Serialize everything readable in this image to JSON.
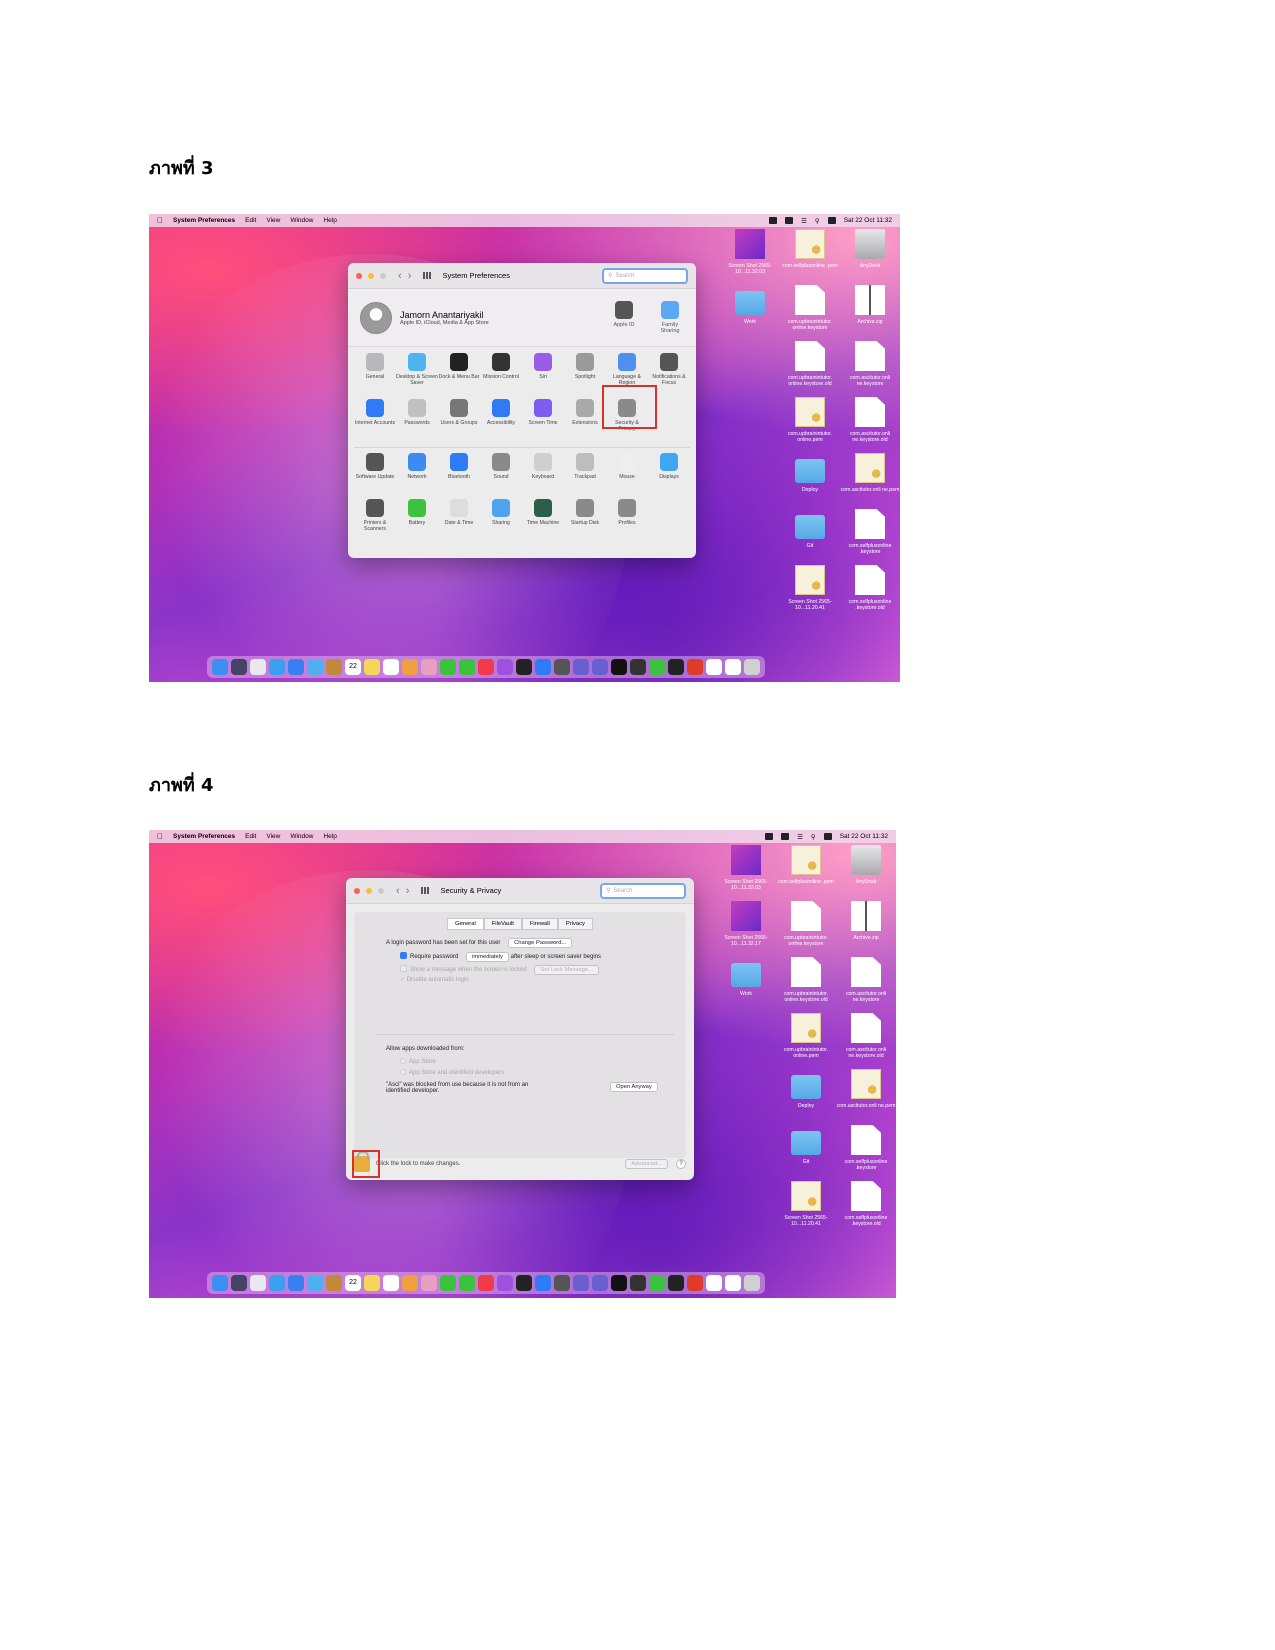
{
  "captions": {
    "fig3": "ภาพที่ 3",
    "fig4": "ภาพที่ 4"
  },
  "menubar": {
    "apple": "",
    "app": "System Preferences",
    "items": [
      "Edit",
      "View",
      "Window",
      "Help"
    ],
    "clock": "Sat 22 Oct 11:32"
  },
  "shot3": {
    "window_title": "System Preferences",
    "search_placeholder": "Search",
    "user_name": "Jamorn Anantariyakil",
    "user_sub": "Apple ID, iCloud, Media & App Store",
    "profile_icons": [
      {
        "label": "Apple ID",
        "icon": "apple-id-icon",
        "color": "#555555"
      },
      {
        "label": "Family Sharing",
        "icon": "family-sharing-icon",
        "color": "#5aa9f5"
      }
    ],
    "rows": [
      [
        {
          "label": "General",
          "icon": "general-icon",
          "color": "#b9b9bd"
        },
        {
          "label": "Desktop & Screen Saver",
          "icon": "desktop-icon",
          "color": "#4fb3f0"
        },
        {
          "label": "Dock & Menu Bar",
          "icon": "dock-icon",
          "color": "#222222"
        },
        {
          "label": "Mission Control",
          "icon": "mission-control-icon",
          "color": "#333333"
        },
        {
          "label": "Siri",
          "icon": "siri-icon",
          "color": "#9b5de5"
        },
        {
          "label": "Spotlight",
          "icon": "spotlight-icon",
          "color": "#9a9a9a"
        },
        {
          "label": "Language & Region",
          "icon": "language-icon",
          "color": "#4f8ff0"
        },
        {
          "label": "Notifications & Focus",
          "icon": "notifications-icon",
          "color": "#555555"
        }
      ],
      [
        {
          "label": "Internet Accounts",
          "icon": "internet-accounts-icon",
          "color": "#2f7bf6"
        },
        {
          "label": "Passwords",
          "icon": "passwords-icon",
          "color": "#c0c0c0"
        },
        {
          "label": "Users & Groups",
          "icon": "users-icon",
          "color": "#777777"
        },
        {
          "label": "Accessibility",
          "icon": "accessibility-icon",
          "color": "#2f7bf6"
        },
        {
          "label": "Screen Time",
          "icon": "screen-time-icon",
          "color": "#7b5ef0"
        },
        {
          "label": "Extensions",
          "icon": "extensions-icon",
          "color": "#aaaaaa"
        },
        {
          "label": "Security & Privacy",
          "icon": "security-icon",
          "color": "#8a8a8a"
        },
        {
          "label": "",
          "icon": "",
          "color": "transparent"
        }
      ],
      [
        {
          "label": "Software Update",
          "icon": "software-update-icon",
          "color": "#555555"
        },
        {
          "label": "Network",
          "icon": "network-icon",
          "color": "#3d8bf0"
        },
        {
          "label": "Bluetooth",
          "icon": "bluetooth-icon",
          "color": "#2f7bf6"
        },
        {
          "label": "Sound",
          "icon": "sound-icon",
          "color": "#8a8a8a"
        },
        {
          "label": "Keyboard",
          "icon": "keyboard-icon",
          "color": "#cfcfcf"
        },
        {
          "label": "Trackpad",
          "icon": "trackpad-icon",
          "color": "#bdbdbd"
        },
        {
          "label": "Mouse",
          "icon": "mouse-icon",
          "color": "#eeeeee"
        },
        {
          "label": "Displays",
          "icon": "displays-icon",
          "color": "#3fa6f2"
        }
      ],
      [
        {
          "label": "Printers & Scanners",
          "icon": "printer-icon",
          "color": "#555555"
        },
        {
          "label": "Battery",
          "icon": "battery-icon",
          "color": "#3cc23c"
        },
        {
          "label": "Date & Time",
          "icon": "clock-icon",
          "color": "#dddddd"
        },
        {
          "label": "Sharing",
          "icon": "sharing-icon",
          "color": "#4fa3ee"
        },
        {
          "label": "Time Machine",
          "icon": "time-machine-icon",
          "color": "#2d5e4a"
        },
        {
          "label": "Startup Disk",
          "icon": "startup-disk-icon",
          "color": "#8a8a8a"
        },
        {
          "label": "Profiles",
          "icon": "profiles-icon",
          "color": "#8a8a8a"
        },
        {
          "label": "",
          "icon": "",
          "color": "transparent"
        }
      ]
    ]
  },
  "shot4": {
    "window_title": "Security & Privacy",
    "search_placeholder": "Search",
    "tabs": [
      "General",
      "FileVault",
      "Firewall",
      "Privacy"
    ],
    "login_text": "A login password has been set for this user",
    "change_password": "Change Password...",
    "require_password": "Require password",
    "require_value": "immediately",
    "require_suffix": "after sleep or screen saver begins",
    "show_message": "Show a message when the screen is locked",
    "set_lock_message": "Set Lock Message...",
    "disable_login": "Disable automatic login",
    "allow_apps": "Allow apps downloaded from:",
    "opt_app_store": "App Store",
    "opt_identified": "App Store and identified developers",
    "blocked_text_1": "\"Asci\" was blocked from use because it is not from an",
    "blocked_text_2": "identified developer.",
    "open_anyway": "Open Anyway",
    "lock_text": "Click the lock to make changes.",
    "advanced": "Advanced...",
    "help": "?"
  },
  "desktop3": [
    {
      "label": "Screen Shot 2565-10...11.32.03",
      "kind": "shotimg"
    },
    {
      "label": "com.selfplusonline .pem",
      "kind": "cert"
    },
    {
      "label": "AnyDesk",
      "kind": "disk"
    },
    {
      "label": "Work",
      "kind": "folder"
    },
    {
      "label": "com.upbrainintutor. online.keystore",
      "kind": "doc"
    },
    {
      "label": "Archive.zip",
      "kind": "zip"
    },
    {
      "label": "",
      "kind": ""
    },
    {
      "label": "com.upbrainintutor. online.keystore.old",
      "kind": "doc"
    },
    {
      "label": "com.ascitutor.onli ne.keystore",
      "kind": "doc"
    },
    {
      "label": "",
      "kind": ""
    },
    {
      "label": "com.upbrainintutor. online.pem",
      "kind": "cert"
    },
    {
      "label": "com.ascitutor.onli ne.keystore.old",
      "kind": "doc"
    },
    {
      "label": "",
      "kind": ""
    },
    {
      "label": "Deploy",
      "kind": "folder"
    },
    {
      "label": "com.ascitutor.onli ne.pem",
      "kind": "cert"
    },
    {
      "label": "",
      "kind": ""
    },
    {
      "label": "Git",
      "kind": "folder"
    },
    {
      "label": "com.selfplusonline .keystore",
      "kind": "doc"
    },
    {
      "label": "",
      "kind": ""
    },
    {
      "label": "Screen Shot 2565-10...11.20.41",
      "kind": "cert"
    },
    {
      "label": "com.selfplusonline .keystore.old",
      "kind": "doc"
    }
  ],
  "desktop4": [
    {
      "label": "Screen Shot 2565-10...11.32.03",
      "kind": "shotimg"
    },
    {
      "label": "com.selfplusonline .pem",
      "kind": "cert"
    },
    {
      "label": "AnyDesk",
      "kind": "disk"
    },
    {
      "label": "Screen Shot 2565-10...11.32.17",
      "kind": "shotimg"
    },
    {
      "label": "com.upbrainintutor. online.keystore",
      "kind": "doc"
    },
    {
      "label": "Archive.zip",
      "kind": "zip"
    },
    {
      "label": "Work",
      "kind": "folder"
    },
    {
      "label": "com.upbrainintutor. online.keystore.old",
      "kind": "doc"
    },
    {
      "label": "com.ascitutor.onli ne.keystore",
      "kind": "doc"
    },
    {
      "label": "",
      "kind": ""
    },
    {
      "label": "com.upbrainintutor. online.pem",
      "kind": "cert"
    },
    {
      "label": "com.ascitutor.onli ne.keystore.old",
      "kind": "doc"
    },
    {
      "label": "",
      "kind": ""
    },
    {
      "label": "Deploy",
      "kind": "folder"
    },
    {
      "label": "com.ascitutor.onli ne.pem",
      "kind": "cert"
    },
    {
      "label": "",
      "kind": ""
    },
    {
      "label": "Git",
      "kind": "folder"
    },
    {
      "label": "com.selfplusonline .keystore",
      "kind": "doc"
    },
    {
      "label": "",
      "kind": ""
    },
    {
      "label": "Screen Shot 2565-10...11.20.41",
      "kind": "cert"
    },
    {
      "label": "com.selfplusonline .keystore.old",
      "kind": "doc"
    }
  ],
  "dock_colors": [
    "#3a8ff0",
    "#444466",
    "#e8e8ee",
    "#3aa0f0",
    "#3a7ff0",
    "#4fb0f0",
    "#c08a3a",
    "#ffffff",
    "#f6d65a",
    "#ffffff",
    "#f0a040",
    "#e8a0c0",
    "#3cc23c",
    "#3cc23c",
    "#f03a4a",
    "#a050e0",
    "#222222",
    "#2f7bf6",
    "#555555",
    "#6a5fd0",
    "#6a5fd0",
    "#111111",
    "#333333",
    "#3cc23c",
    "#222222",
    "#e03a2a",
    "#ffffff",
    "#ffffff",
    "#d0d0d0"
  ],
  "dock_calendar_day": "22"
}
